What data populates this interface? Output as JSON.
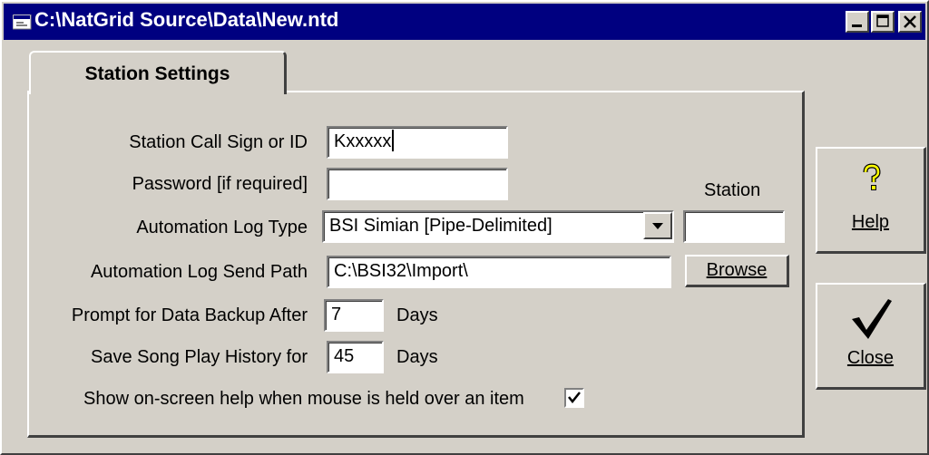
{
  "window": {
    "title": "C:\\NatGrid Source\\Data\\New.ntd"
  },
  "tab": {
    "label": "Station Settings"
  },
  "form": {
    "call_sign_label": "Station Call Sign or ID",
    "call_sign_value": "Kxxxxx",
    "password_label": "Password [if required]",
    "password_value": "",
    "log_type_label": "Automation Log Type",
    "log_type_value": "BSI Simian [Pipe-Delimited]",
    "station_label": "Station",
    "station_value": "",
    "send_path_label": "Automation Log Send Path",
    "send_path_value": "C:\\BSI32\\Import\\",
    "browse_label": "Browse",
    "backup_label": "Prompt for Data Backup After",
    "backup_value": "7",
    "backup_unit": "Days",
    "history_label": "Save Song Play History for",
    "history_value": "45",
    "history_unit": "Days",
    "help_checkbox_label": "Show on-screen help when mouse is held over an item",
    "help_checkbox_checked": true
  },
  "buttons": {
    "help_label": "Help",
    "close_label": "Close"
  },
  "icons": {
    "app": "app-icon",
    "help": "question-mark-icon",
    "close": "checkmark-icon"
  }
}
